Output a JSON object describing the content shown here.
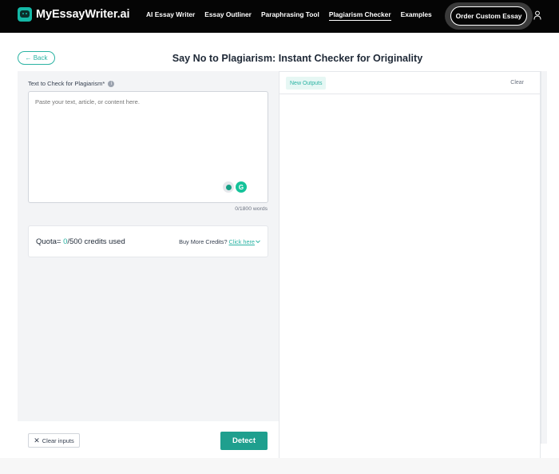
{
  "header": {
    "logo_text": "MyEssayWriter.ai",
    "nav": [
      {
        "label": "AI Essay Writer"
      },
      {
        "label": "Essay Outliner"
      },
      {
        "label": "Paraphrasing Tool"
      },
      {
        "label": "Plagiarism Checker",
        "active": true
      },
      {
        "label": "Examples"
      }
    ],
    "order_button": "Order Custom Essay",
    "user_icon": "user-icon"
  },
  "title_row": {
    "back_label": "← Back",
    "title": "Say No to Plagiarism: Instant Checker for Originality"
  },
  "input_panel": {
    "field_label": "Text to Check for Plagiarism*",
    "info_icon": "i",
    "placeholder": "Paste your text, article, or content here.",
    "word_count": "0/1800 words",
    "quota": {
      "prefix": "Quota= ",
      "used": "0",
      "suffix": "/500 credits used",
      "buy_more": "Buy More Credits? ",
      "click_here": "Click here"
    },
    "clear_inputs": "Clear inputs",
    "detect": "Detect"
  },
  "output_panel": {
    "new_outputs": "New Outputs",
    "clear": "Clear"
  },
  "colors": {
    "accent": "#2bb3a3",
    "detect_button": "#1f9f8e",
    "header_bg": "#050505"
  }
}
